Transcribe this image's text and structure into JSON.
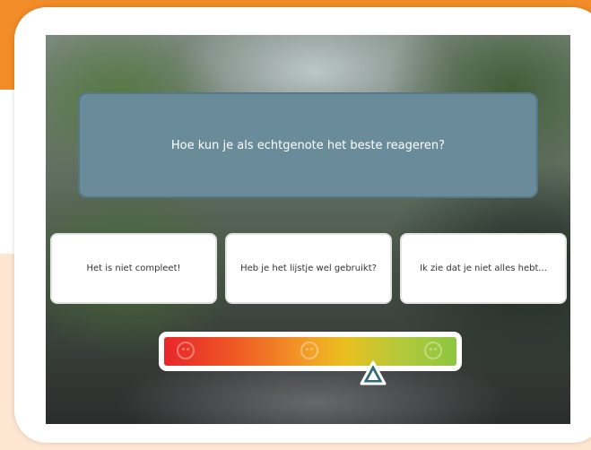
{
  "quiz": {
    "question": "Hoe kun je als echtgenote het beste reageren?",
    "answers": [
      "Het is niet compleet!",
      "Heb je het lijstje wel gebruikt?",
      "Ik zie dat je niet alles hebt..."
    ]
  },
  "mood_meter": {
    "level": 0.7,
    "faces": [
      "sad-face-icon",
      "neutral-face-icon",
      "happy-face-icon"
    ],
    "colors": {
      "low": "#e8262a",
      "mid": "#f3a026",
      "high": "#8cc63f"
    }
  },
  "theme": {
    "accent": "#f28c28",
    "question_bg": "#6a8c9a"
  }
}
